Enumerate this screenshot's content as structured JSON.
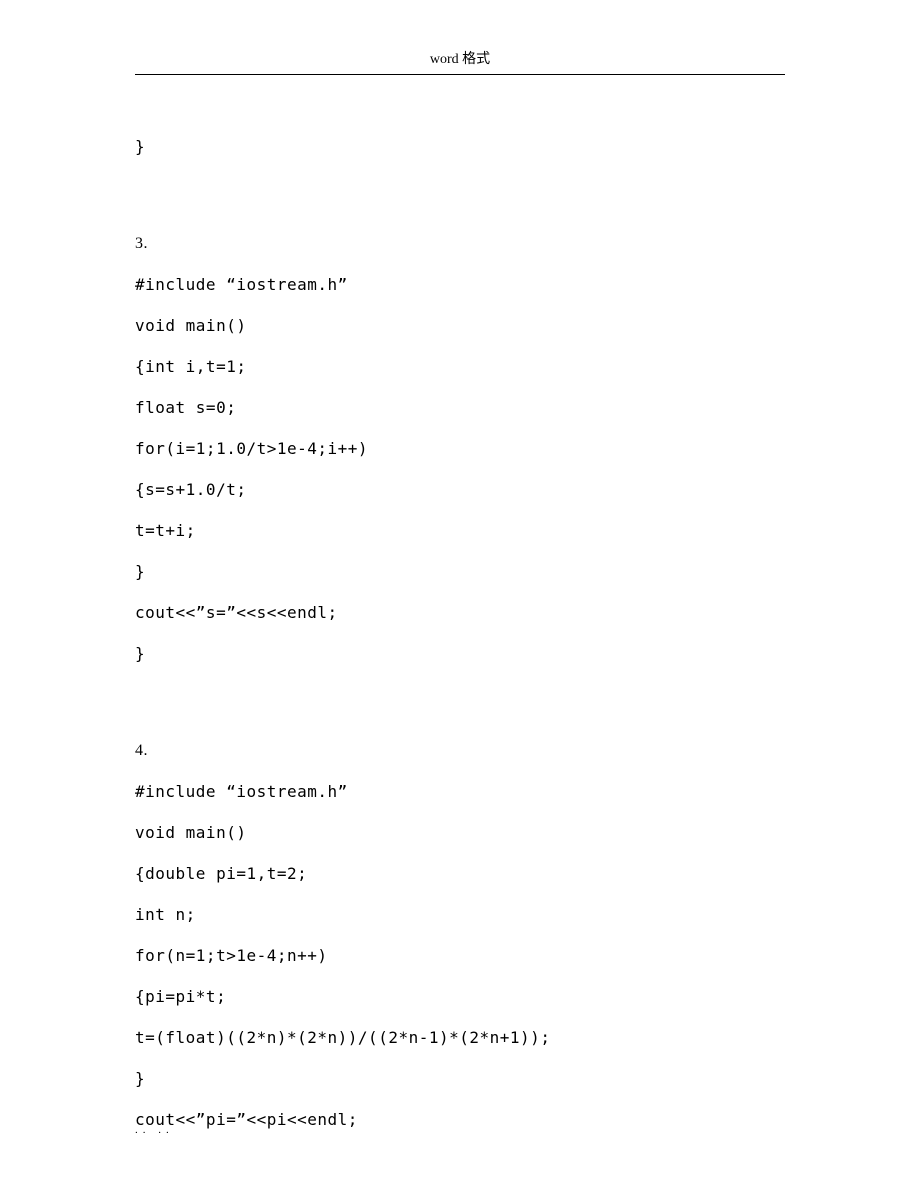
{
  "header": {
    "title": "word 格式"
  },
  "content": {
    "lines": [
      "}",
      "",
      "",
      "3.",
      "",
      "#include “iostream.h”",
      "",
      "void main()",
      "",
      "{int i,t=1;",
      "",
      "float s=0;",
      "",
      "for(i=1;1.0/t>1e-4;i++)",
      "",
      "{s=s+1.0/t;",
      "",
      "t=t+i;",
      "",
      "}",
      "",
      "cout<<”s=”<<s<<endl;",
      "",
      "}",
      "",
      "",
      "4.",
      "",
      "#include “iostream.h”",
      "",
      "void main()",
      "",
      "{double pi=1,t=2;",
      "",
      "int n;",
      "",
      "for(n=1;t>1e-4;n++)",
      "",
      "{pi=pi*t;",
      "",
      "t=(float)((2*n)*(2*n))/((2*n-1)*(2*n+1));",
      "",
      "}",
      "",
      "cout<<”pi=”<<pi<<endl;"
    ]
  },
  "footer": {
    "text": ".. .."
  }
}
